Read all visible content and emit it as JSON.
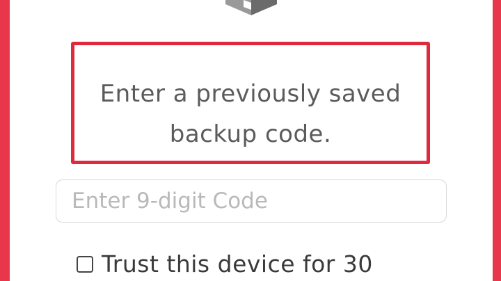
{
  "colors": {
    "accent_border": "#e8364b",
    "highlight_box": "#df2a3d",
    "text": "#5b5b5b",
    "placeholder": "#b9b9b9"
  },
  "header": {
    "logo_icon": "cube-logo-icon"
  },
  "instruction": {
    "line1": "Enter a previously saved",
    "line2": "backup code."
  },
  "code_input": {
    "placeholder": "Enter 9-digit Code",
    "value": ""
  },
  "trust": {
    "checked": false,
    "label": "Trust this device for 30"
  }
}
